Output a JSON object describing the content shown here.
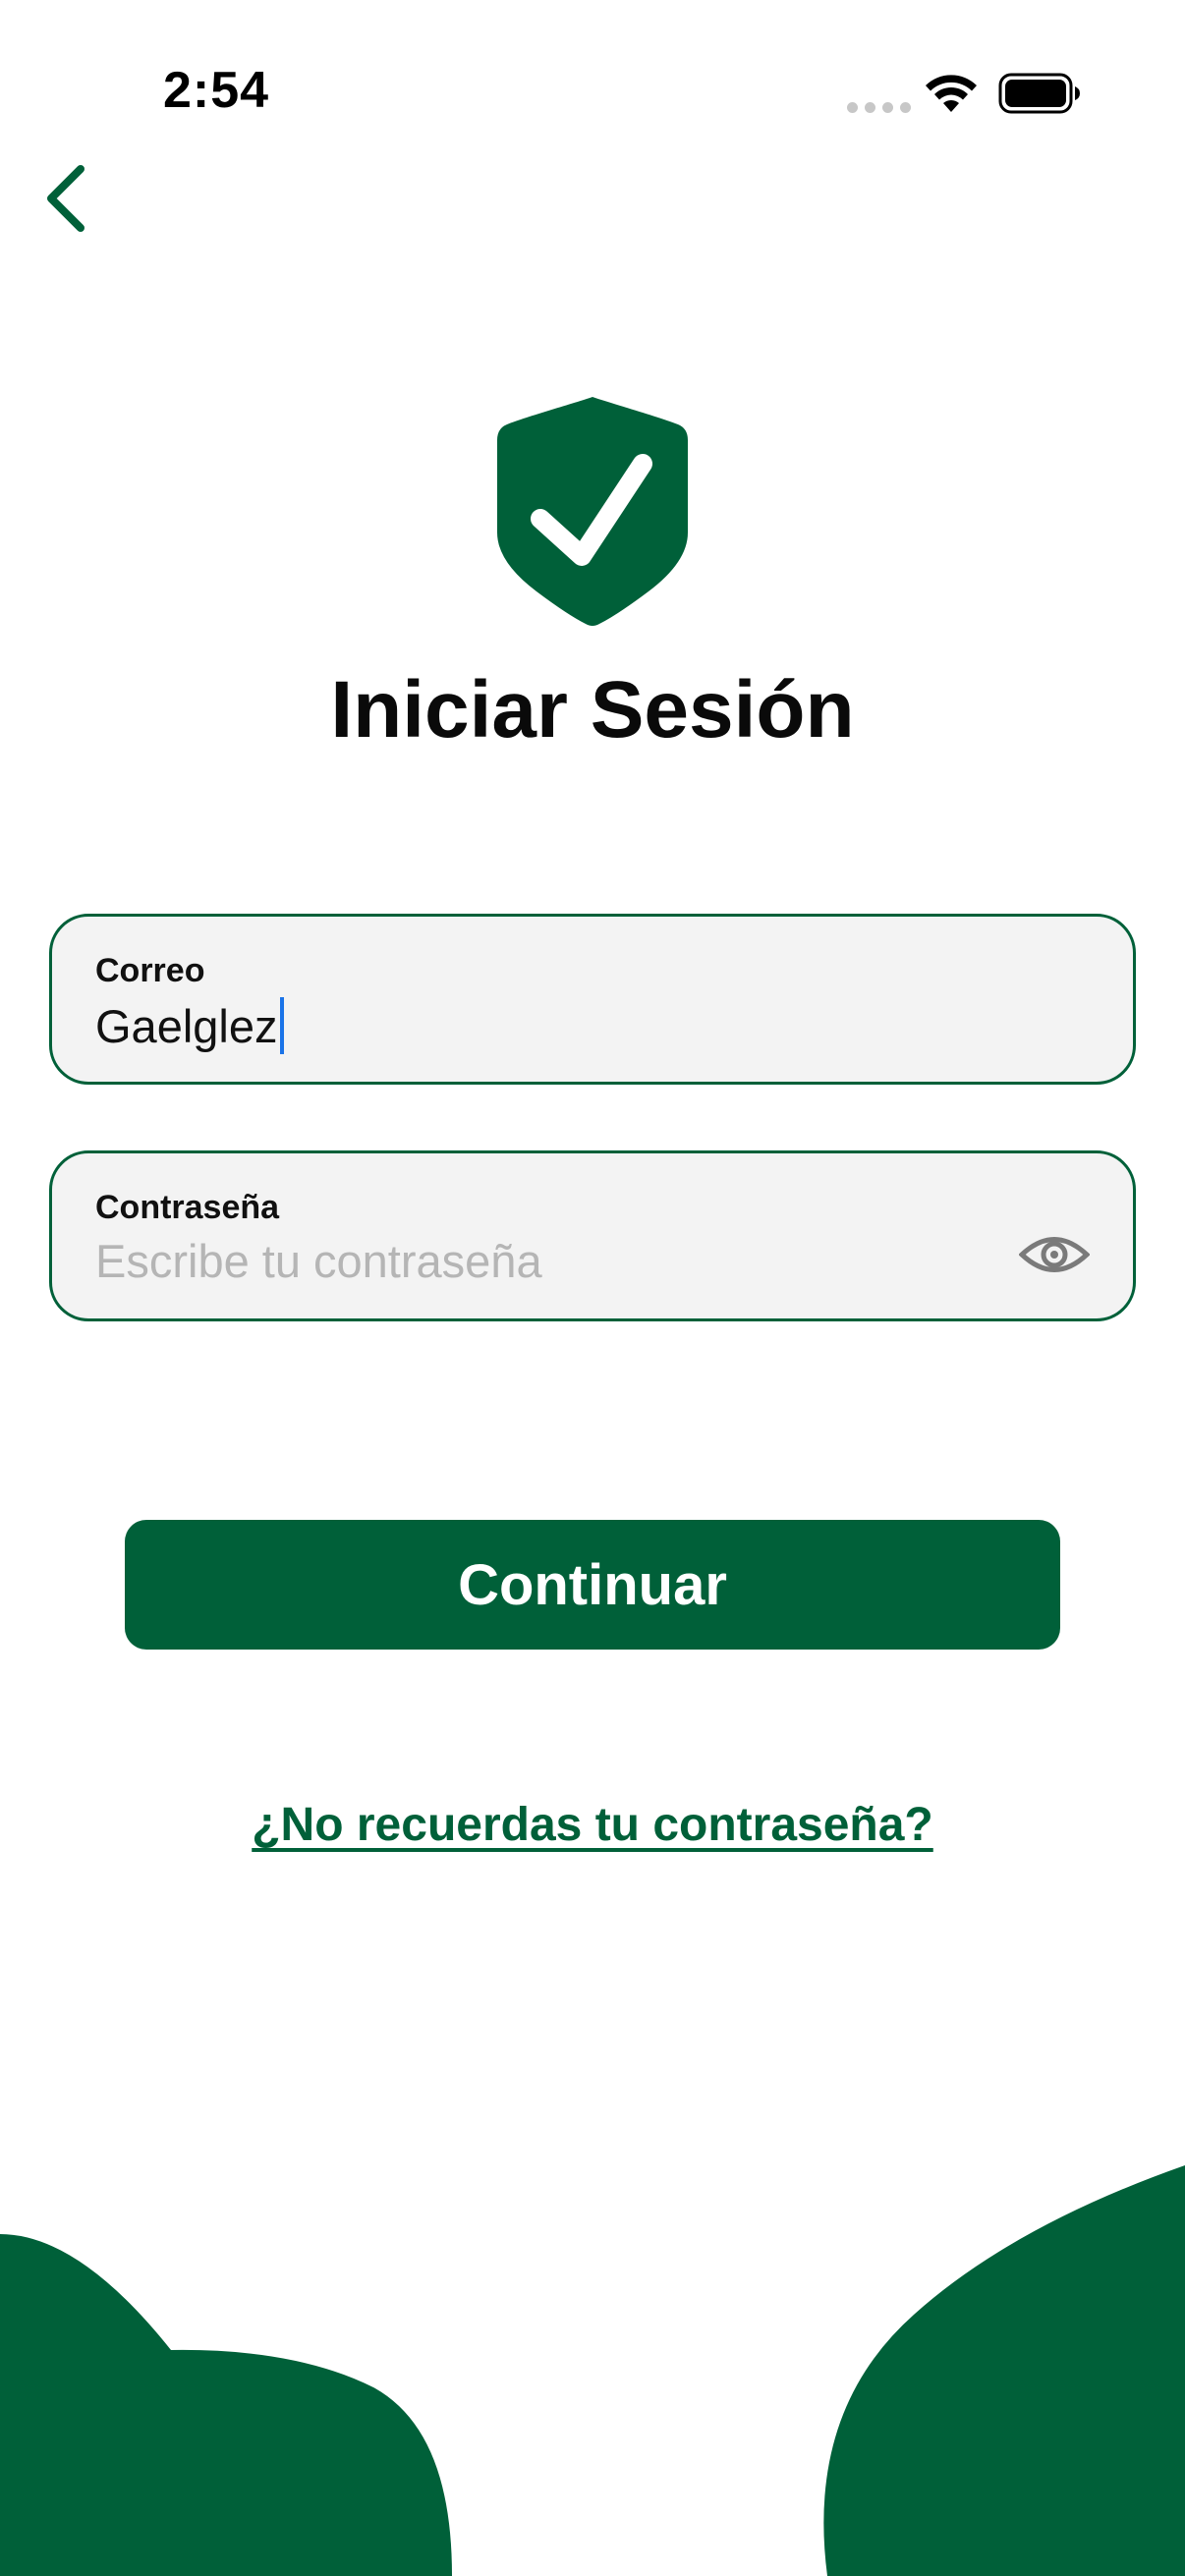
{
  "status_bar": {
    "time": "2:54"
  },
  "icons": {
    "back": "chevron-left-icon",
    "shield": "shield-check-icon",
    "eye": "eye-icon",
    "wifi": "wifi-icon",
    "battery": "battery-icon"
  },
  "colors": {
    "brand": "#006039",
    "field_background": "#f3f3f3",
    "placeholder": "#b5b5b5",
    "caret": "#1a73e8"
  },
  "login": {
    "title": "Iniciar Sesión",
    "email": {
      "label": "Correo",
      "value": "Gaelglez"
    },
    "password": {
      "label": "Contraseña",
      "placeholder": "Escribe tu contraseña",
      "value": ""
    },
    "continue_label": "Continuar",
    "forgot_label": "¿No recuerdas tu contraseña?"
  }
}
